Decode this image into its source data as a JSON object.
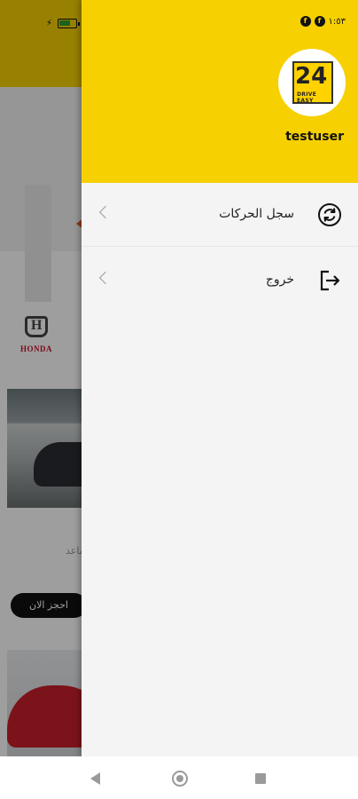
{
  "status_bar": {
    "clock": "١:٥٣",
    "icons": [
      "charging-icon",
      "battery-icon",
      "signal-icon",
      "wifi-icon",
      "alarm-icon",
      "data-off-icon",
      "app-notification-icon"
    ]
  },
  "background_app": {
    "brand_logo_text": "HONDA",
    "card_text": "مقاعد",
    "book_button_label": "احجز الان"
  },
  "drawer": {
    "logo": {
      "number": "24",
      "caption": "DRIVE EASY"
    },
    "username": "testuser",
    "menu": [
      {
        "label": "سجل الحركات",
        "icon": "history-sync-icon"
      },
      {
        "label": "خروج",
        "icon": "logout-icon"
      }
    ]
  },
  "nav_bar": {
    "buttons": [
      "back-icon",
      "home-icon",
      "recents-icon"
    ]
  },
  "colors": {
    "accent": "#f6d000",
    "drawer_bg": "#f4f4f4",
    "text": "#222222"
  }
}
